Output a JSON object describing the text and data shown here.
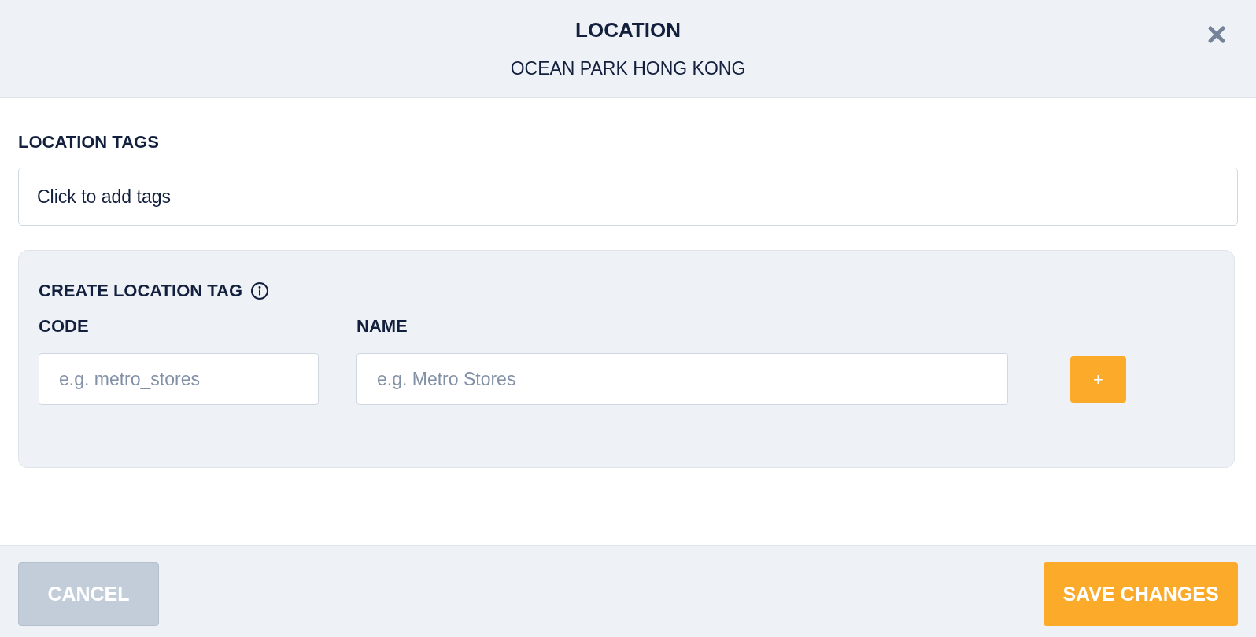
{
  "header": {
    "title": "LOCATION",
    "subtitle": "OCEAN PARK HONG KONG"
  },
  "tags_field": {
    "label": "LOCATION TAGS",
    "placeholder": "Click to add tags"
  },
  "create_tag": {
    "title": "CREATE LOCATION TAG",
    "fields": [
      {
        "label": "CODE",
        "placeholder": "e.g. metro_stores"
      },
      {
        "label": "NAME",
        "placeholder": "e.g. Metro Stores"
      }
    ],
    "add_button": "+"
  },
  "footer": {
    "buttons": [
      {
        "kind": "cancel",
        "label": "CANCEL",
        "disabled": true
      },
      {
        "kind": "save",
        "label": "SAVE CHANGES",
        "disabled": false
      }
    ]
  }
}
